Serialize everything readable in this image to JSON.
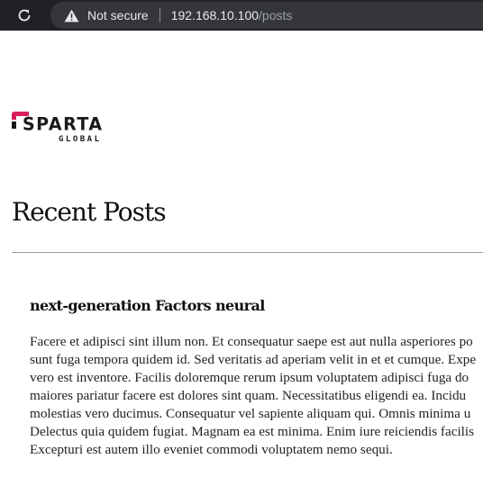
{
  "browser": {
    "security_label": "Not secure",
    "url_host": "192.168.10.100",
    "url_path": "/posts"
  },
  "logo": {
    "word": "SPARTA",
    "sub": "GLOBAL",
    "accent_color": "#d81e5b"
  },
  "page": {
    "title": "Recent Posts"
  },
  "post": {
    "title": "next-generation Factors neural",
    "body_lines": [
      "Facere et adipisci sint illum non. Et consequatur saepe est aut nulla asperiores po",
      "sunt fuga tempora quidem id. Sed veritatis ad aperiam velit in et et cumque. Expe",
      "vero est inventore. Facilis doloremque rerum ipsum voluptatem adipisci fuga do",
      "maiores pariatur facere est dolores sint quam. Necessitatibus eligendi ea. Incidu",
      "molestias vero ducimus. Consequatur vel sapiente aliquam qui. Omnis minima u",
      "Delectus quia quidem fugiat. Magnam ea est minima. Enim iure reiciendis facilis",
      "Excepturi est autem illo eveniet commodi voluptatem nemo sequi."
    ]
  }
}
